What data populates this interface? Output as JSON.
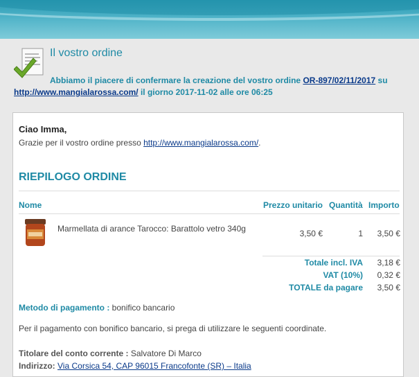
{
  "header": {
    "title": "Il vostro ordine",
    "intro_prefix": "Abbiamo il piacere di confermare la creazione del vostro ordine",
    "order_ref": "OR-897/02/11/2017",
    "intro_su": "su",
    "site_url": "http://www.mangialarossa.com/",
    "intro_date": "il giorno 2017-11-02 alle ore 06:25"
  },
  "greeting": {
    "hello": "Ciao Imma,",
    "thanks_prefix": "Grazie per il vostro ordine presso",
    "thanks_url": "http://www.mangialarossa.com/",
    "thanks_suffix": "."
  },
  "summary": {
    "title": "RIEPILOGO ORDINE",
    "columns": {
      "name": "Nome",
      "unit_price": "Prezzo unitario",
      "qty": "Quantità",
      "amount": "Importo"
    },
    "items": [
      {
        "name": "Marmellata di arance Tarocco: Barattolo vetro 340g",
        "unit_price": "3,50 €",
        "qty": "1",
        "amount": "3,50 €"
      }
    ],
    "totals": [
      {
        "label": "Totale incl. IVA",
        "value": "3,18 €"
      },
      {
        "label": "VAT (10%)",
        "value": "0,32 €"
      },
      {
        "label": "TOTALE da pagare",
        "value": "3,50 €"
      }
    ]
  },
  "payment": {
    "label": "Metodo di pagamento :",
    "value": "bonifico bancario",
    "note": "Per il pagamento con bonifico bancario, si prega di utilizzare le seguenti coordinate.",
    "holder_label": "Titolare del conto corrente :",
    "holder_value": "Salvatore Di Marco",
    "address_label": "Indirizzo:",
    "address_value": "Via Corsica 54, CAP 96015 Francofonte (SR) – Italia"
  },
  "colors": {
    "accent": "#1f8aa5",
    "link": "#0a3a8a",
    "header_bar": "#2a9ab3"
  },
  "icons": {
    "header": "document-check-icon",
    "product": "jam-jar-image"
  }
}
